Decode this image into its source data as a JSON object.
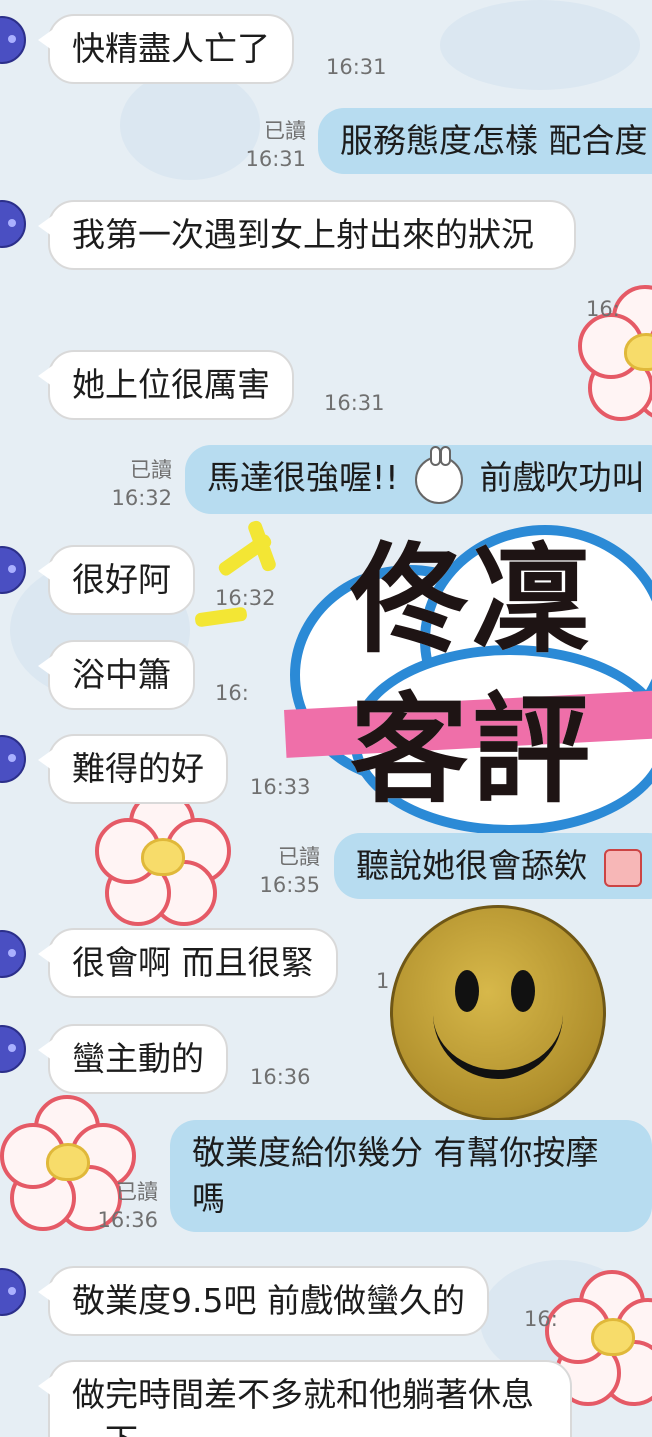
{
  "messages": [
    {
      "text": "快精盡人亡了",
      "time": "16:31"
    },
    {
      "text": "服務態度怎樣 配合度",
      "read": "已讀",
      "time": "16:31"
    },
    {
      "text": "我第一次遇到女上射出來的狀況",
      "time": "16:"
    },
    {
      "text": "她上位很厲害",
      "time": "16:31"
    },
    {
      "text_before_icon": "馬達很強喔!!",
      "text_after_icon": "前戲吹功叫",
      "read": "已讀",
      "time": "16:32",
      "icon": "bunny-sticker-icon"
    },
    {
      "text": "很好阿",
      "time": "16:32"
    },
    {
      "text": "浴中簫",
      "time": "16:"
    },
    {
      "text": "難得的好",
      "time": "16:33"
    },
    {
      "text": "聽說她很會舔欸",
      "read": "已讀",
      "time": "16:35",
      "icon": "emoji-icon"
    },
    {
      "text": "很會啊 而且很緊",
      "time": "1"
    },
    {
      "text": "蠻主動的",
      "time": "16:36"
    },
    {
      "text": "敬業度給你幾分 有幫你按摩嗎",
      "read": "已讀",
      "time": "16:36"
    },
    {
      "text": "敬業度9.5吧 前戲做蠻久的",
      "time": "16:"
    },
    {
      "text": "做完時間差不多就和他躺著休息一下"
    }
  ],
  "watermark": {
    "line1": "佟凜",
    "line2": "客評"
  },
  "colors": {
    "outgoing": "#b7dcf0",
    "incoming": "#ffffff",
    "avatar": "#4a4fc2",
    "title_outline": "#2b8ad6",
    "ribbon": "#ef6fa9"
  }
}
